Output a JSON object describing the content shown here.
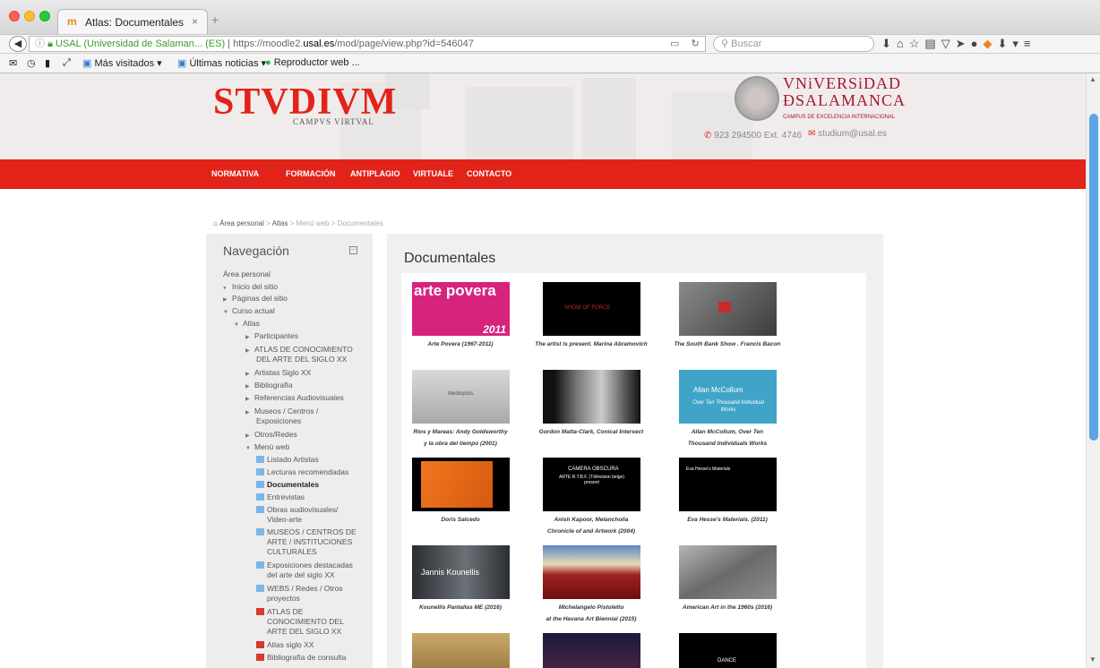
{
  "browser": {
    "tab_title": "Atlas: Documentales",
    "tab_icon": "m",
    "tab_close": "×",
    "new_tab": "+",
    "url_secure_label": "USAL (Universidad de Salaman... (ES)",
    "url_prefix": "https://moodle2.",
    "url_domain": "usal.es",
    "url_path": "/mod/page/view.php?id=546047",
    "search_placeholder": "Buscar",
    "bookmarks": {
      "mas_visitados": "Más visitados ▾",
      "ultimas_noticias": "Últimas noticias ▾",
      "reproductor": "Reproductor web ..."
    }
  },
  "site": {
    "logo": "STVDIVM",
    "logo_sub": "CAMPVS VIRTVAL",
    "univ_line1": "VNiVERSiDAD",
    "univ_line2": "ÐSALAMANCA",
    "univ_tagline": "CAMPUS DE EXCELENCIA INTERNACIONAL",
    "phone": "923 294500 Ext. 4746",
    "email": "studium@usal.es"
  },
  "menu": [
    "NORMATIVA",
    "FORMACIÓN",
    "ANTIPLAGIO",
    "VIRTUALE",
    "CONTACTO"
  ],
  "breadcrumb": {
    "home": "Área personal",
    "sep1": ">",
    "atlas": "Atlas",
    "sep2": ">",
    "menu_web": "Menú web",
    "sep3": ">",
    "current": "Documentales"
  },
  "nav": {
    "title": "Navegación",
    "items": [
      {
        "label": "Área personal"
      },
      {
        "label": "Inicio del sitio"
      },
      {
        "label": "Páginas del sitio"
      },
      {
        "label": "Curso actual"
      },
      {
        "label": "Atlas"
      },
      {
        "label": "Participantes"
      },
      {
        "label": "ATLAS DE CONOCIMIENTO"
      },
      {
        "label": "DEL ARTE DEL SIGLO XX"
      },
      {
        "label": "Artistas Siglo XX"
      },
      {
        "label": "Bibliografía"
      },
      {
        "label": "Referencias Audiovisuales"
      },
      {
        "label": "Museos / Centros /"
      },
      {
        "label": "Exposiciones"
      },
      {
        "label": "Otros/Redes"
      },
      {
        "label": "Menú web"
      },
      {
        "label": "Listado Artistas"
      },
      {
        "label": "Lecturas recomendadas"
      },
      {
        "label": "Documentales"
      },
      {
        "label": "Entrevistas"
      },
      {
        "label": "Obras audiovisuales/"
      },
      {
        "label": "Video-arte"
      },
      {
        "label": "MUSEOS / CENTROS DE"
      },
      {
        "label": "ARTE / INSTITUCIONES"
      },
      {
        "label": "CULTURALES"
      },
      {
        "label": "Exposiciones destacadas"
      },
      {
        "label": "del arte del siglo XX"
      },
      {
        "label": "WEBS / Redes / Otros"
      },
      {
        "label": "proyectos"
      },
      {
        "label": "ATLAS DE"
      },
      {
        "label": "CONOCIMIENTO DEL"
      },
      {
        "label": "ARTE DEL SIGLO XX"
      },
      {
        "label": "Atlas siglo XX"
      },
      {
        "label": "Bibliografía de consulta"
      }
    ]
  },
  "main": {
    "title": "Documentales",
    "videos": [
      {
        "thumb_text": "arte povera",
        "thumb_year": "2011",
        "caption1": "Arte Povera (1967-2011)",
        "caption2": ""
      },
      {
        "thumb_text": "SHOW OF FORCE",
        "caption1": "The artist is present. Marina Abramovich",
        "caption2": ""
      },
      {
        "thumb_text": "",
        "caption1": "The South Bank Show . Francis Bacon",
        "caption2": ""
      },
      {
        "thumb_text": "Mediopolis",
        "caption1": "Rios y Mareas: Andy Goldsworthy",
        "caption2": "y la obra del tiempo (2001)"
      },
      {
        "thumb_text": "",
        "caption1": "Gordon Matta-Clark, Conical Intersect",
        "caption2": ""
      },
      {
        "thumb_text": "Allan McCollum",
        "thumb_sub": "Over Ten Thousand Individual Works",
        "caption1": "Allan McCollum, Over Ten",
        "caption2": "Thousand Individuals Works"
      },
      {
        "thumb_text": "",
        "caption1": "Doris Salcedo",
        "caption2": ""
      },
      {
        "thumb_text": "CAMERA OBSCURA",
        "thumb_sub": "ARTE R.T.B.F. (Télévision belge) present",
        "caption1": "Anish Kapoor, Melancholia",
        "caption2": "Chronicle of and Artwork (2004)"
      },
      {
        "thumb_text": "Eva Hesse's Materials",
        "caption1": "Eva Hesse's Materials. (2011)",
        "caption2": ""
      },
      {
        "thumb_text": "Jannis Kounellis",
        "caption1": "Kounellis Pantallas ME (2016)",
        "caption2": ""
      },
      {
        "thumb_text": "",
        "caption1": "Michelangelo Pistoletto",
        "caption2": "at the Havana Art Biennial (2015)"
      },
      {
        "thumb_text": "",
        "caption1": "American Art in the 1960s (2016)",
        "caption2": ""
      },
      {
        "thumb_text": "",
        "caption1": "",
        "caption2": ""
      },
      {
        "thumb_text": "",
        "caption1": "",
        "caption2": ""
      },
      {
        "thumb_text": "DANCE",
        "caption1": "",
        "caption2": ""
      }
    ]
  },
  "colors": {
    "brand_red": "#e2231a",
    "usal_red": "#a6192e",
    "scroll_thumb": "#5aa5e6"
  }
}
